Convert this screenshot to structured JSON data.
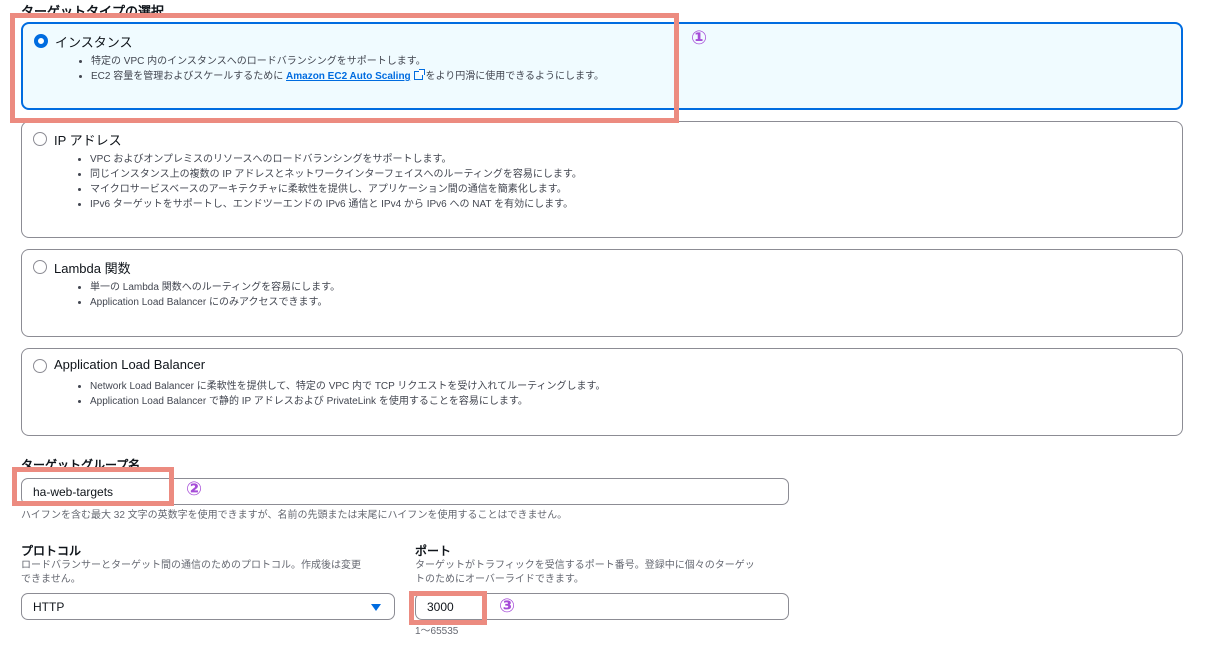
{
  "target_type": {
    "title": "ターゲットタイプの選択",
    "options": [
      {
        "label": "インスタンス",
        "selected": true,
        "bullets": [
          "特定の VPC 内のインスタンスへのロードバランシングをサポートします。",
          "EC2 容量を管理およびスケールするために",
          "をより円滑に使用できるようにします。"
        ],
        "link_text": "Amazon EC2 Auto Scaling"
      },
      {
        "label": "IP アドレス",
        "selected": false,
        "bullets": [
          "VPC およびオンプレミスのリソースへのロードバランシングをサポートします。",
          "同じインスタンス上の複数の IP アドレスとネットワークインターフェイスへのルーティングを容易にします。",
          "マイクロサービスベースのアーキテクチャに柔軟性を提供し、アプリケーション間の通信を簡素化します。",
          "IPv6 ターゲットをサポートし、エンドツーエンドの IPv6 通信と IPv4 から IPv6 への NAT を有効にします。"
        ]
      },
      {
        "label": "Lambda 関数",
        "selected": false,
        "bullets": [
          "単一の Lambda 関数へのルーティングを容易にします。",
          "Application Load Balancer にのみアクセスできます。"
        ]
      },
      {
        "label": "Application Load Balancer",
        "selected": false,
        "bullets": [
          "Network Load Balancer に柔軟性を提供して、特定の VPC 内で TCP リクエストを受け入れてルーティングします。",
          "Application Load Balancer で静的 IP アドレスおよび PrivateLink を使用することを容易にします。"
        ]
      }
    ]
  },
  "target_group_name": {
    "label": "ターゲットグループ名",
    "value": "ha-web-targets",
    "help": "ハイフンを含む最大 32 文字の英数字を使用できますが、名前の先頭または末尾にハイフンを使用することはできません。"
  },
  "protocol": {
    "label": "プロトコル",
    "description_line1": "ロードバランサーとターゲット間の通信のためのプロトコル。作成後は変更",
    "description_line2": "できません。",
    "value": "HTTP"
  },
  "port": {
    "label": "ポート",
    "description_line1": "ターゲットがトラフィックを受信するポート番号。登録中に個々のターゲッ",
    "description_line2": "トのためにオーバーライドできます。",
    "value": "3000",
    "constraint": "1〜65535"
  },
  "annotations": {
    "marker1": "①",
    "marker2": "②",
    "marker3": "③",
    "highlight_color": "#ec8b80",
    "marker_color": "#a64cd8"
  },
  "colors": {
    "accent": "#006ce0",
    "selected_bg": "#f0fbff"
  }
}
